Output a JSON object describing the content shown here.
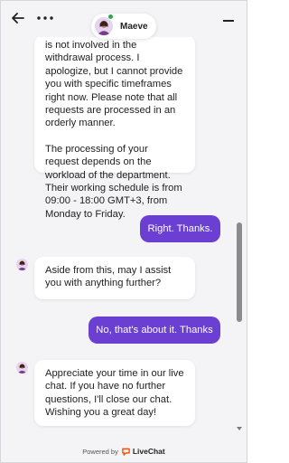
{
  "header": {
    "agent_name": "Maeve",
    "back_icon": "arrow-left-icon",
    "more_icon": "more-dots-icon",
    "minimize_icon": "minimize-icon"
  },
  "messages": [
    {
      "from": "agent",
      "paragraphs": [
        "is not involved in the withdrawal process. I apologize, but I cannot provide you with specific timeframes right now. Please note that all requests are processed in an orderly manner.",
        "The processing of your request depends on the workload of the department. Their working schedule is from 09:00 - 18:00 GMT+3, from Monday to Friday."
      ]
    },
    {
      "from": "user",
      "text": "Right. Thanks."
    },
    {
      "from": "agent",
      "text": "Aside from this, may I assist you with anything further?"
    },
    {
      "from": "user",
      "text": "No, that's about it. Thanks"
    },
    {
      "from": "agent",
      "text": "Appreciate your time in our live chat. If you have no further questions, I'll close our chat. Wishing you a great day!"
    }
  ],
  "footer": {
    "powered_by": "Powered by",
    "brand": "LiveChat"
  },
  "colors": {
    "accent": "#6a3fd1",
    "background": "#f4f3f6",
    "online_status": "#2fa84f",
    "brand_orange": "#ff5100"
  }
}
